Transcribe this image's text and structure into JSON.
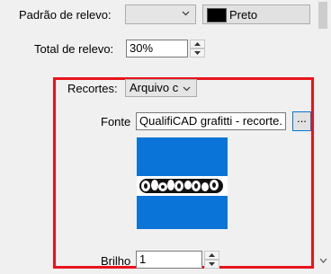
{
  "emboss": {
    "pattern_label": "Padrão de relevo:",
    "pattern_value": "",
    "color_swatch": "#000000",
    "color_label": "Preto",
    "total_label": "Total de relevo:",
    "total_value": "30%"
  },
  "cutouts": {
    "label": "Recortes:",
    "value": "Arquivo c",
    "font_label": "Fonte",
    "font_value": "QualifiCAD grafitti - recorte.",
    "browse_label": "...",
    "preview_text": "QUALIFICAD",
    "preview_bg": "#0a74d9",
    "brightness_label": "Brilho",
    "brightness_value": "1"
  },
  "highlight_color": "#e8141c"
}
